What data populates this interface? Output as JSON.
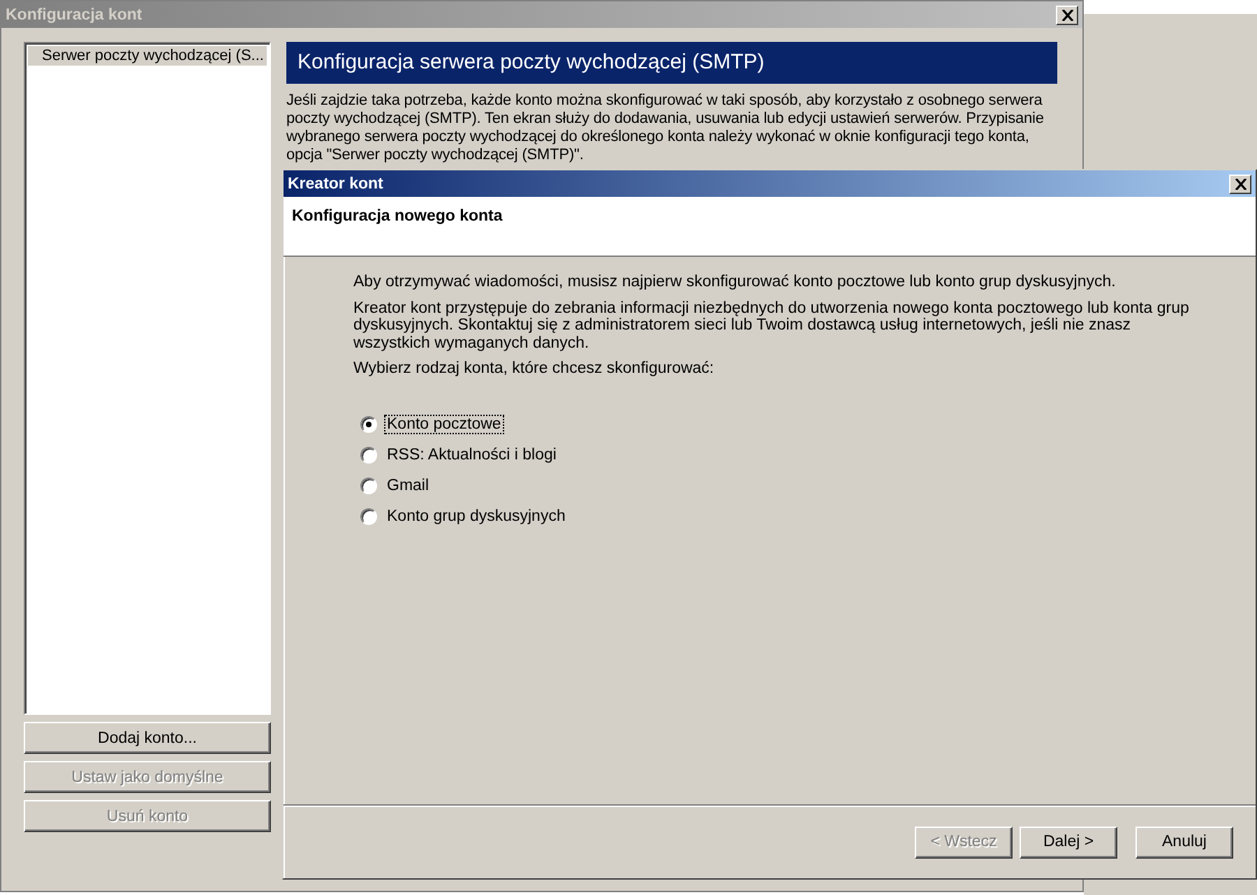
{
  "accounts_window": {
    "title": "Konfiguracja kont",
    "account_list": [
      {
        "label": "Serwer poczty wychodzącej (S...",
        "selected": true
      }
    ],
    "buttons": [
      {
        "label": "Dodaj konto...",
        "disabled": false
      },
      {
        "label": "Ustaw jako domyślne",
        "disabled": true
      },
      {
        "label": "Usuń konto",
        "disabled": true
      }
    ],
    "heading": "Konfiguracja serwera poczty wychodzącej (SMTP)",
    "description": "Jeśli zajdzie taka potrzeba, każde konto można skonfigurować w taki sposób, aby korzystało z osobnego serwera poczty wychodzącej (SMTP). Ten ekran służy do dodawania, usuwania lub edycji ustawień serwerów. Przypisanie wybranego serwera poczty wychodzącej do określonego konta należy wykonać w oknie konfiguracji tego konta, opcja \"Serwer poczty wychodzącej (SMTP)\"."
  },
  "wizard": {
    "title": "Kreator kont",
    "header": "Konfiguracja nowego konta",
    "paragraphs": [
      "Aby otrzymywać wiadomości, musisz najpierw skonfigurować konto pocztowe lub konto grup dyskusyjnych.",
      "Kreator kont przystępuje do zebrania informacji niezbędnych do utworzenia nowego konta pocztowego lub konta grup dyskusyjnych. Skontaktuj się z administratorem sieci lub Twoim dostawcą usług internetowych, jeśli nie znasz wszystkich wymaganych danych.",
      "Wybierz rodzaj konta, które chcesz skonfigurować:"
    ],
    "options": [
      {
        "label": "Konto pocztowe",
        "selected": true
      },
      {
        "label": "RSS: Aktualności i blogi",
        "selected": false
      },
      {
        "label": "Gmail",
        "selected": false
      },
      {
        "label": "Konto grup dyskusyjnych",
        "selected": false
      }
    ],
    "buttons": [
      {
        "label": "< Wstecz",
        "disabled": true
      },
      {
        "label": "Dalej >",
        "disabled": false
      },
      {
        "label": "Anuluj",
        "disabled": false
      }
    ]
  }
}
